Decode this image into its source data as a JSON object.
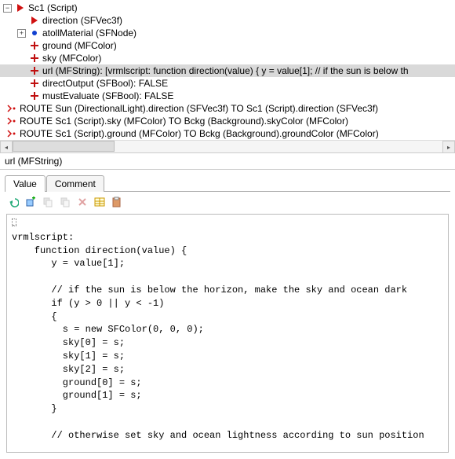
{
  "tree": {
    "root": {
      "label": "Sc1 (Script)",
      "children": [
        {
          "label": "direction (SFVec3f)",
          "iconColor": "#1030c0"
        },
        {
          "label": "atollMaterial (SFNode)",
          "iconColor": "#1030c0",
          "expandable": true
        },
        {
          "label": "ground (MFColor)",
          "iconColor": "#c01010"
        },
        {
          "label": "sky (MFColor)",
          "iconColor": "#c01010"
        },
        {
          "label": "url (MFString): [vrmlscript:    function direction(value) {     y = value[1];     // if the sun is below th",
          "iconColor": "#c01010",
          "selected": true
        },
        {
          "label": "directOutput (SFBool): FALSE",
          "iconColor": "#c01010"
        },
        {
          "label": "mustEvaluate (SFBool): FALSE",
          "iconColor": "#c01010"
        }
      ]
    },
    "routes": [
      "ROUTE Sun (DirectionalLight).direction (SFVec3f) TO Sc1 (Script).direction (SFVec3f)",
      "ROUTE Sc1 (Script).sky (MFColor) TO Bckg (Background).skyColor (MFColor)",
      "ROUTE Sc1 (Script).ground (MFColor) TO Bckg (Background).groundColor (MFColor)"
    ]
  },
  "fieldHeader": "url (MFString)",
  "tabs": {
    "value": "Value",
    "comment": "Comment"
  },
  "editor": {
    "text": "\nvrmlscript:\n    function direction(value) {\n       y = value[1];\n\n       // if the sun is below the horizon, make the sky and ocean dark\n       if (y > 0 || y < -1)\n       {\n         s = new SFColor(0, 0, 0);\n         sky[0] = s;\n         sky[1] = s;\n         sky[2] = s;\n         ground[0] = s;\n         ground[1] = s;\n       }\n\n       // otherwise set sky and ocean lightness according to sun position"
  },
  "chart_data": null
}
